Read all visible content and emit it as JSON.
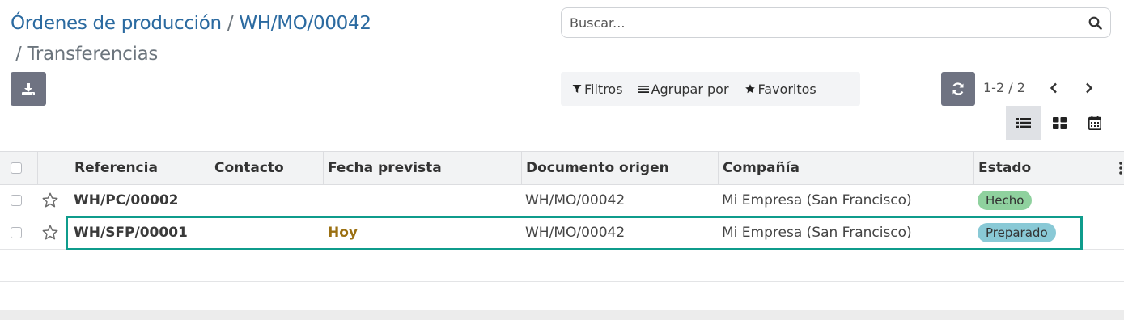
{
  "breadcrumb": {
    "items": [
      {
        "label": "Órdenes de producción"
      },
      {
        "label": "WH/MO/00042"
      }
    ],
    "separator": "/",
    "current": "Transferencias"
  },
  "search": {
    "placeholder": "Buscar..."
  },
  "filters": {
    "filters_label": "Filtros",
    "groupby_label": "Agrupar por",
    "favorites_label": "Favoritos"
  },
  "pager": {
    "value": "1-2 / 2"
  },
  "views": [
    "list",
    "kanban",
    "calendar"
  ],
  "table": {
    "columns": [
      "Referencia",
      "Contacto",
      "Fecha prevista",
      "Documento origen",
      "Compañía",
      "Estado"
    ],
    "rows": [
      {
        "ref": "WH/PC/00002",
        "contact": "",
        "date": "",
        "origin": "WH/MO/00042",
        "company": "Mi Empresa (San Francisco)",
        "status": "Hecho",
        "status_color": "#8fd19e"
      },
      {
        "ref": "WH/SFP/00001",
        "contact": "",
        "date": "Hoy",
        "origin": "WH/MO/00042",
        "company": "Mi Empresa (San Francisco)",
        "status": "Preparado",
        "status_color": "#89c9d6"
      }
    ]
  },
  "colors": {
    "breadcrumb_link": "#2b6aa0",
    "button_bg": "#6f7382",
    "highlight": "#0f9c8c",
    "today": "#9b7012"
  },
  "icons": {
    "download": "download-icon",
    "search": "search-icon",
    "filter": "filter-icon",
    "groupby": "list-lines-icon",
    "favorites": "star-icon",
    "refresh": "refresh-icon",
    "prev": "chevron-left-icon",
    "next": "chevron-right-icon",
    "list_view": "list-view-icon",
    "kanban_view": "kanban-view-icon",
    "calendar_view": "calendar-icon",
    "row_star": "star-outline-icon",
    "optional_columns": "vertical-dots-icon"
  }
}
